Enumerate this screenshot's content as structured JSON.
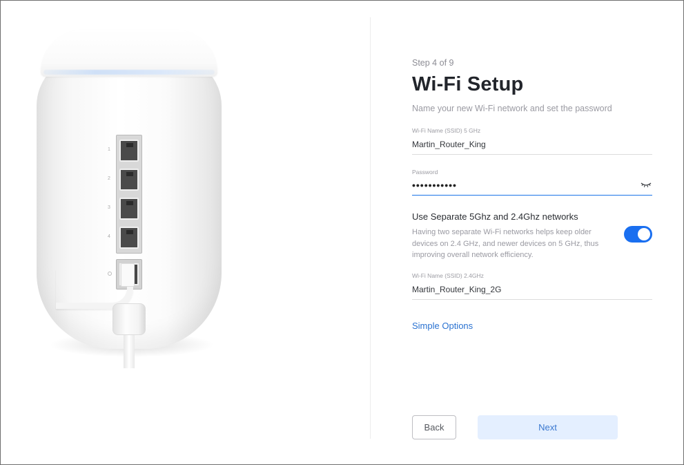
{
  "wizard": {
    "step": "Step 4 of 9",
    "title": "Wi-Fi Setup",
    "subtitle": "Name your new Wi-Fi network and set the password"
  },
  "ssid_5ghz": {
    "label": "Wi-Fi Name (SSID) 5 GHz",
    "value": "Martin_Router_King"
  },
  "password": {
    "label": "Password",
    "masked_value": "•••••••••••",
    "icon": "eye-closed-icon"
  },
  "separate_networks": {
    "title": "Use Separate 5Ghz and 2.4Ghz networks",
    "description": "Having two separate Wi-Fi networks helps keep older devices on 2.4 GHz, and newer devices on 5 GHz, thus improving overall network efficiency.",
    "enabled": true
  },
  "ssid_24ghz": {
    "label": "Wi-Fi Name (SSID) 2.4GHz",
    "value": "Martin_Router_King_2G"
  },
  "links": {
    "simple_options": "Simple Options"
  },
  "buttons": {
    "back": "Back",
    "next": "Next"
  },
  "device": {
    "port_numbers": [
      "1",
      "2",
      "3",
      "4"
    ]
  },
  "colors": {
    "accent": "#1a6ff0",
    "link": "#2a72d1",
    "next_bg": "#e4efff"
  }
}
